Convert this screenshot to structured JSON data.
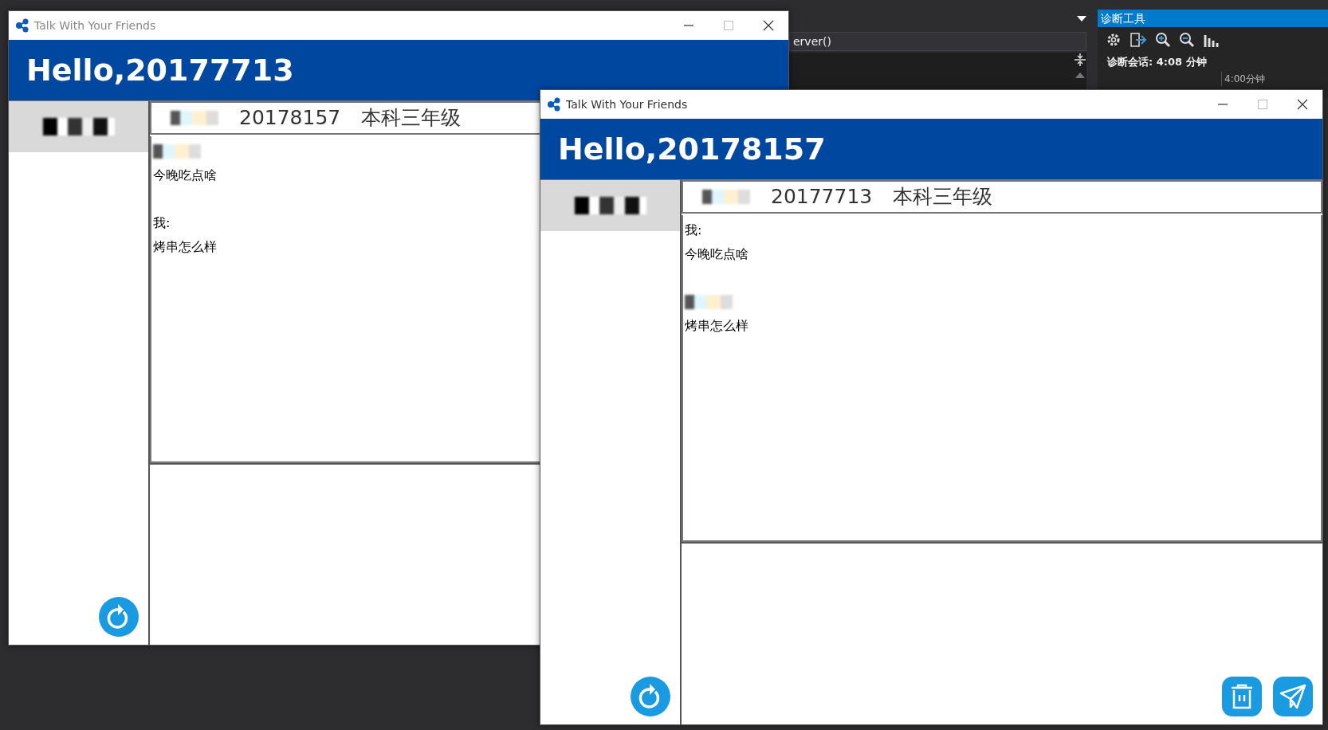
{
  "ide": {
    "dropdown_text": "erver()",
    "panel": {
      "title": "诊断工具",
      "session": "诊断会话: 4:08 分钟",
      "timeline_label": "4:00分钟"
    }
  },
  "windows": [
    {
      "title": "Talk With Your Friends",
      "header": "Hello,20177713",
      "contacts": [
        {
          "redacted": true,
          "selected": true
        }
      ],
      "peer": {
        "redacted": true,
        "id": "20178157",
        "grade": "本科三年级"
      },
      "messages": [
        {
          "sender": {
            "redacted": true
          },
          "text": "今晚吃点啥"
        },
        {
          "sender": {
            "redacted": false,
            "label": "我:"
          },
          "text": "烤串怎么样"
        }
      ],
      "sidebar_buttons": [
        {
          "kind": "refresh"
        }
      ]
    },
    {
      "title": "Talk With Your Friends",
      "header": "Hello,20178157",
      "contacts": [
        {
          "redacted": true,
          "selected": true
        }
      ],
      "peer": {
        "redacted": true,
        "id": "20177713",
        "grade": "本科三年级"
      },
      "messages": [
        {
          "sender": {
            "redacted": false,
            "label": "我:"
          },
          "text": "今晚吃点啥"
        },
        {
          "sender": {
            "redacted": true
          },
          "text": "烤串怎么样"
        }
      ],
      "sidebar_buttons": [
        {
          "kind": "refresh"
        }
      ],
      "input_actions": [
        {
          "kind": "delete"
        },
        {
          "kind": "send"
        }
      ]
    }
  ]
}
